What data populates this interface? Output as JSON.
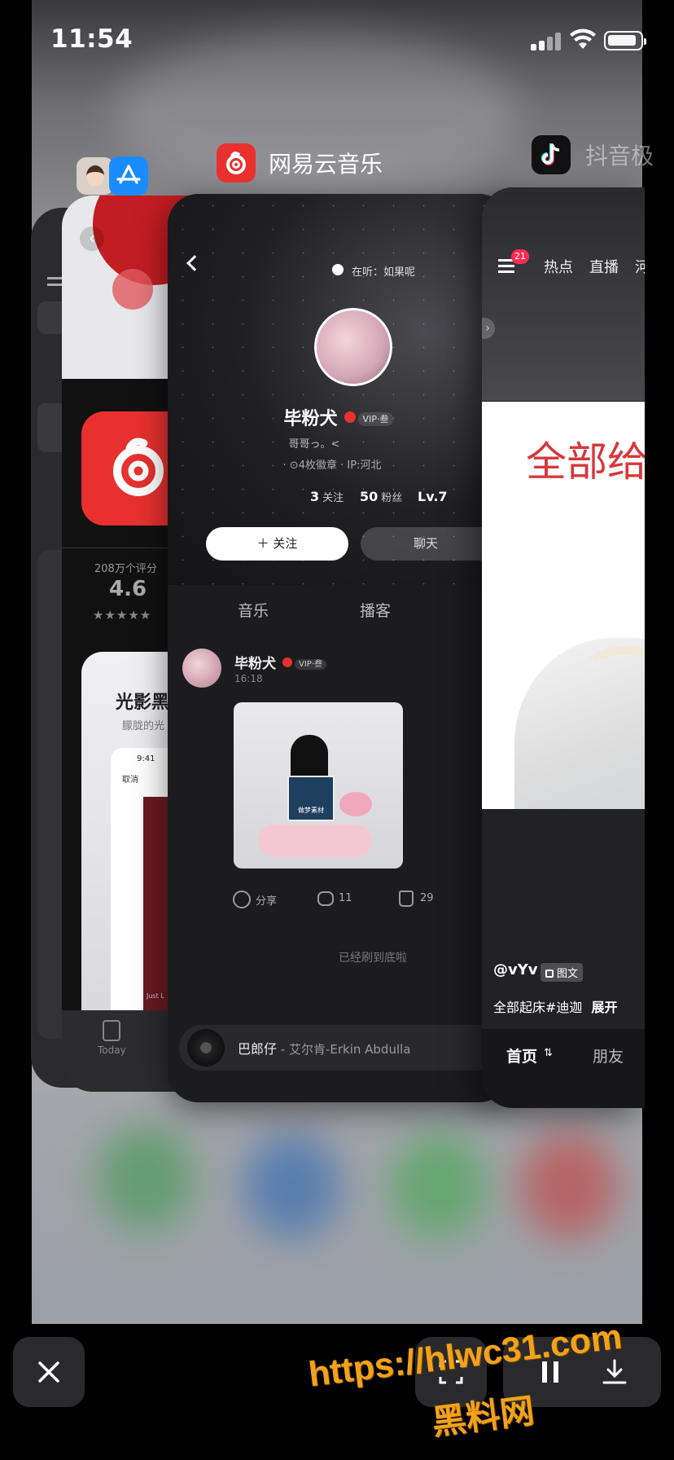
{
  "status": {
    "time": "11:54"
  },
  "app_labels": {
    "netease": "网易云音乐",
    "douyin": "抖音极"
  },
  "appstore_card": {
    "ratings_count": "208万个评分",
    "rating_value": "4.6",
    "stars": "★★★★★",
    "promo_title": "光影黑",
    "promo_sub": "朦胧的光",
    "promo_phone_time": "9:41",
    "promo_cancel": "取消",
    "promo_phone_bottom": "Just L",
    "tab_today": "Today"
  },
  "netease_card": {
    "listening": "在听：如果呢",
    "username": "毕粉犬",
    "vip_badge": "VIP·叁",
    "signature": "哥哥っ。<",
    "meta": "· ⊙4枚徽章 · IP:河北",
    "stats": [
      {
        "num": "3",
        "label": "关注"
      },
      {
        "num": "50",
        "label": "粉丝"
      },
      {
        "num": "Lv.7",
        "label": ""
      }
    ],
    "follow_button": "＋ 关注",
    "chat_button": "聊天",
    "tabs": [
      "音乐",
      "播客"
    ],
    "post": {
      "username": "毕粉犬",
      "vip_badge": "VIP·叁",
      "time": "16:18",
      "image_caption": "做梦素材",
      "share_label": "分享",
      "comments": "11",
      "likes": "29"
    },
    "end_text": "已经刷到底啦",
    "player": {
      "song": "巴郎仔",
      "artist": " - 艾尔肯-Erkin Abdulla"
    }
  },
  "douyin_card": {
    "badge": "21",
    "nav": [
      "热点",
      "直播",
      "河"
    ],
    "big_text": "全部给",
    "author": "@vYv",
    "type_tag": "图文",
    "caption": "全部起床#迪迦",
    "expand": "展开",
    "bottom_tabs": [
      "首页",
      "朋友"
    ]
  },
  "watermark": {
    "line1": "https://hlwc31.com",
    "line2": "黑料网"
  },
  "colors": {
    "netease_red": "#e8312f",
    "douyin_badge": "#fe2c55",
    "watermark": "#f2a21a",
    "appstore_blue": "#1a8cff"
  }
}
